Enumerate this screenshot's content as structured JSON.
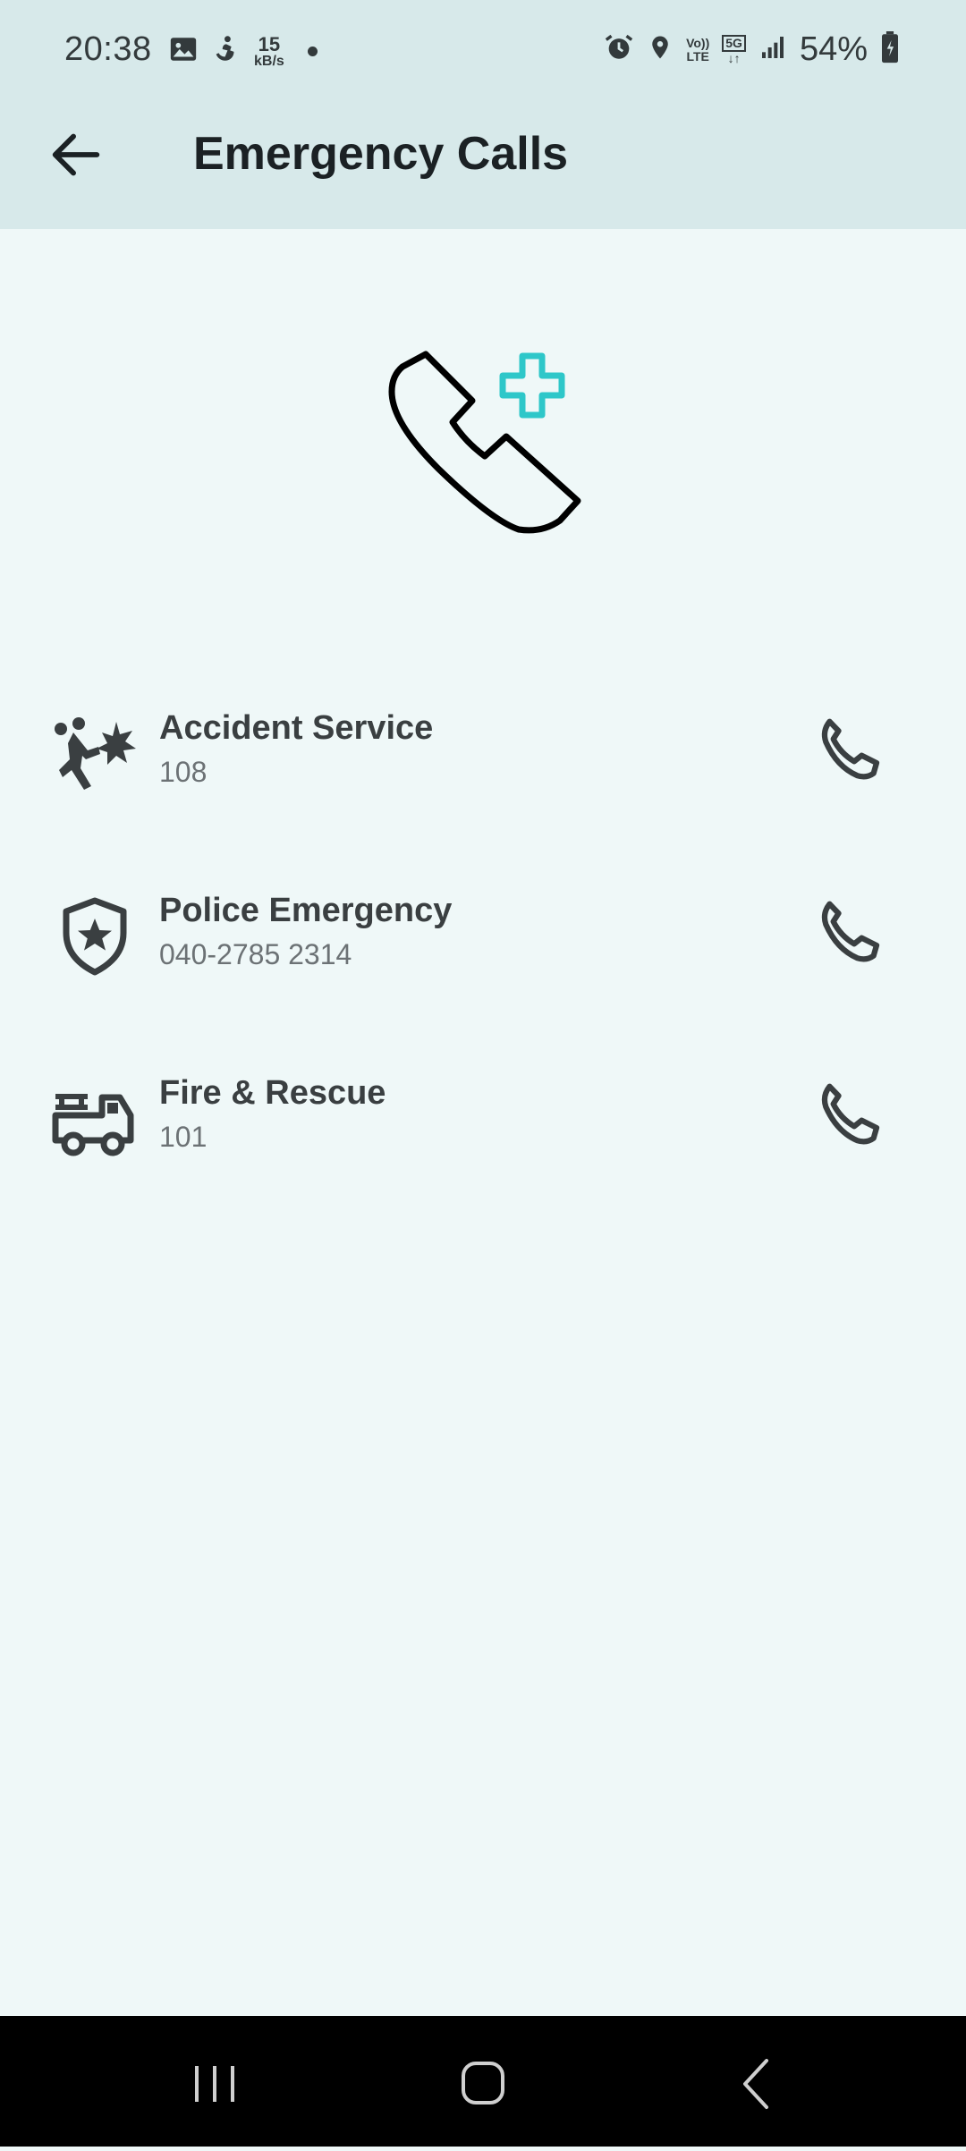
{
  "status_bar": {
    "time": "20:38",
    "net_speed_value": "15",
    "net_speed_unit": "kB/s",
    "volte_top": "Vo))",
    "volte_bottom": "LTE",
    "network_top": "5G",
    "network_bottom": "↓↑",
    "battery": "54%",
    "icons": [
      "image-icon",
      "accessibility-icon",
      "alarm-icon",
      "location-icon",
      "signal-icon",
      "battery-charging-icon"
    ]
  },
  "header": {
    "title": "Emergency Calls",
    "back_icon": "arrow-left-icon"
  },
  "hero": {
    "icon": "emergency-phone-icon",
    "accent_color": "#2ec7c9"
  },
  "contacts": [
    {
      "name": "Accident Service",
      "number": "108",
      "icon": "accident-icon"
    },
    {
      "name": "Police Emergency",
      "number": "040-2785 2314",
      "icon": "police-shield-icon"
    },
    {
      "name": "Fire & Rescue",
      "number": "101",
      "icon": "fire-truck-icon"
    }
  ],
  "nav_bar": {
    "items": [
      "recent-apps-icon",
      "home-icon",
      "back-icon"
    ]
  }
}
